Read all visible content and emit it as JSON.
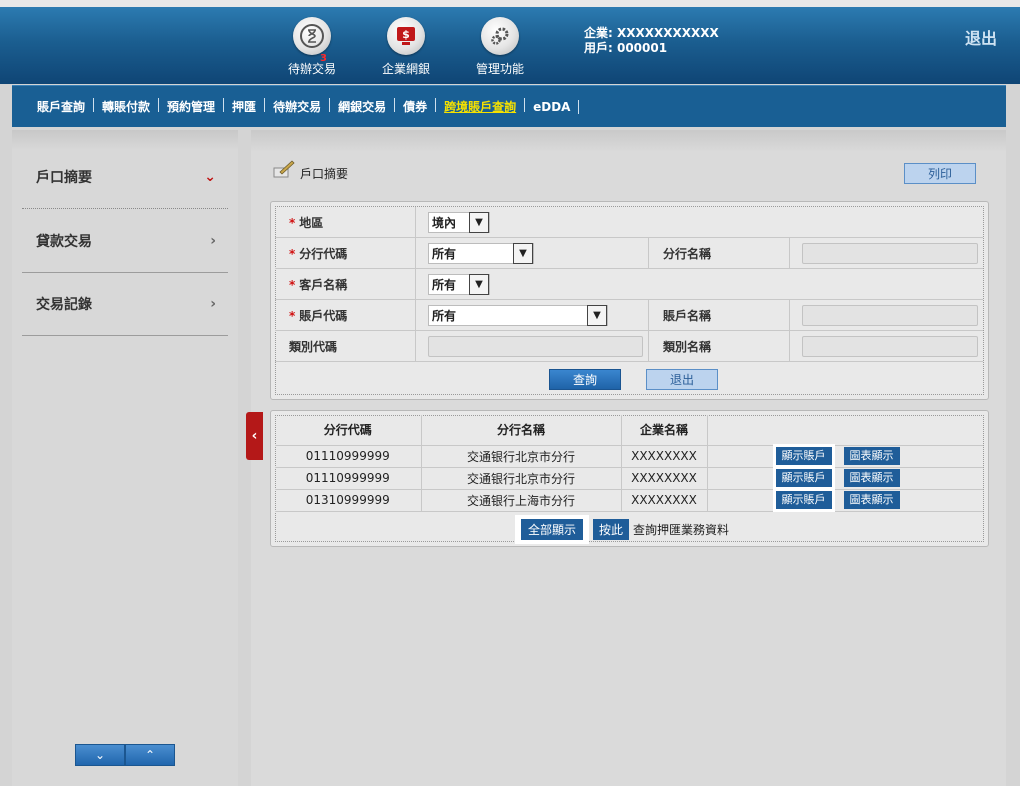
{
  "header": {
    "icons": [
      {
        "label": "待辦交易",
        "badge": "3"
      },
      {
        "label": "企業網銀",
        "badge": ""
      },
      {
        "label": "管理功能",
        "badge": ""
      }
    ],
    "company_line": "企業: XXXXXXXXXXX",
    "user_line": "用戶: 000001",
    "logout": "退出"
  },
  "nav": {
    "items": [
      "賬戶查詢",
      "轉賬付款",
      "預約管理",
      "押匯",
      "待辦交易",
      "網銀交易",
      "債券",
      "跨境賬戶查詢",
      "eDDA"
    ],
    "active_index": 7
  },
  "sidebar": {
    "items": [
      {
        "label": "戶口摘要",
        "chevron": "⌄"
      },
      {
        "label": "貸款交易",
        "chevron": "›"
      },
      {
        "label": "交易記錄",
        "chevron": "›"
      }
    ],
    "down": "⌄",
    "up": "⌃"
  },
  "main": {
    "title": "戶口摘要",
    "print": "列印",
    "form": {
      "region_label": "地區",
      "region_value": "境內",
      "branch_code_label": "分行代碼",
      "branch_code_value": "所有",
      "branch_name_label": "分行名稱",
      "customer_label": "客戶名稱",
      "customer_value": "所有",
      "account_code_label": "賬戶代碼",
      "account_code_value": "所有",
      "account_name_label": "賬戶名稱",
      "category_code_label": "類別代碼",
      "category_name_label": "類別名稱",
      "query": "查詢",
      "exit": "退出"
    },
    "table": {
      "headers": [
        "分行代碼",
        "分行名稱",
        "企業名稱",
        ""
      ],
      "rows": [
        {
          "code": "01110999999",
          "name": "交通银行北京市分行",
          "company": "XXXXXXXX",
          "show": "顯示賬戶",
          "chart": "圖表顯示"
        },
        {
          "code": "01110999999",
          "name": "交通银行北京市分行",
          "company": "XXXXXXXX",
          "show": "顯示賬戶",
          "chart": "圖表顯示"
        },
        {
          "code": "01310999999",
          "name": "交通银行上海市分行",
          "company": "XXXXXXXX",
          "show": "顯示賬戶",
          "chart": "圖表顯示"
        }
      ],
      "show_all": "全部顯示",
      "click_here": "按此",
      "footer_text": "查詢押匯業務資料"
    }
  }
}
